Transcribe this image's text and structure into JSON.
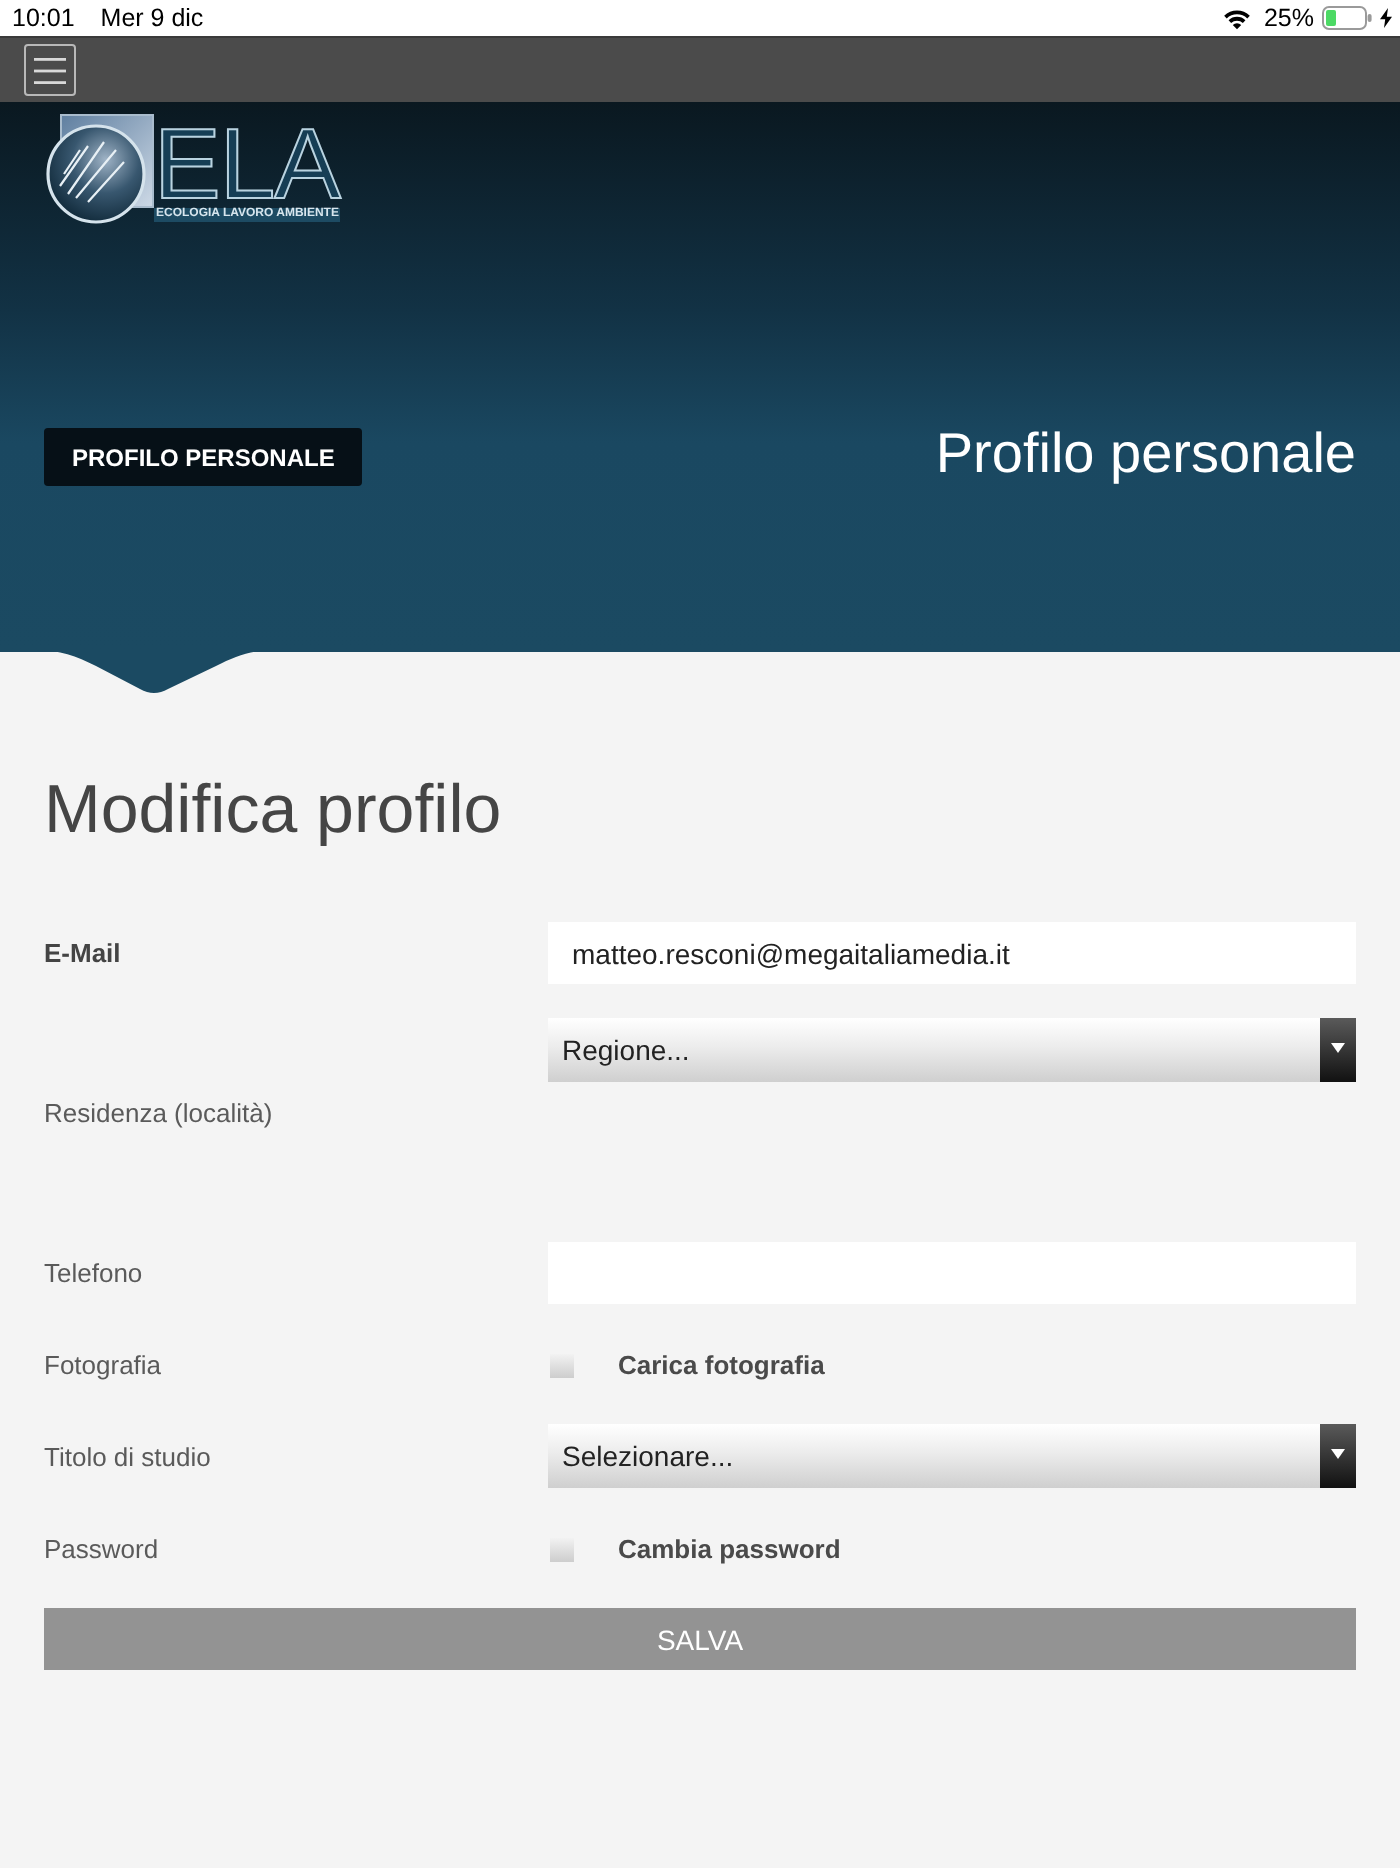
{
  "status_bar": {
    "time": "10:01",
    "date": "Mer 9 dic",
    "battery": "25%"
  },
  "header": {
    "logo": {
      "name": "ELA",
      "tagline": "ECOLOGIA LAVORO AMBIENTE"
    },
    "badge": "PROFILO PERSONALE",
    "title": "Profilo personale"
  },
  "form": {
    "title": "Modifica profilo",
    "rows": [
      {
        "kind": "input",
        "label": "E-Mail",
        "strong": true,
        "value": "matteo.resconi@megaitaliamedia.it"
      },
      {
        "kind": "region-select",
        "label": "Residenza (località)",
        "strong": false,
        "placeholder": "Regione..."
      },
      {
        "kind": "input",
        "label": "Telefono",
        "strong": false
      },
      {
        "kind": "checkbox",
        "label": "Fotografia",
        "strong": false,
        "option": "Carica fotografia",
        "checked": false
      },
      {
        "kind": "select",
        "label": "Titolo di studio",
        "strong": false,
        "placeholder": "Selezionare..."
      },
      {
        "kind": "checkbox",
        "label": "Password",
        "strong": false,
        "option": "Cambia password",
        "checked": false
      }
    ],
    "submit": "SALVA"
  }
}
